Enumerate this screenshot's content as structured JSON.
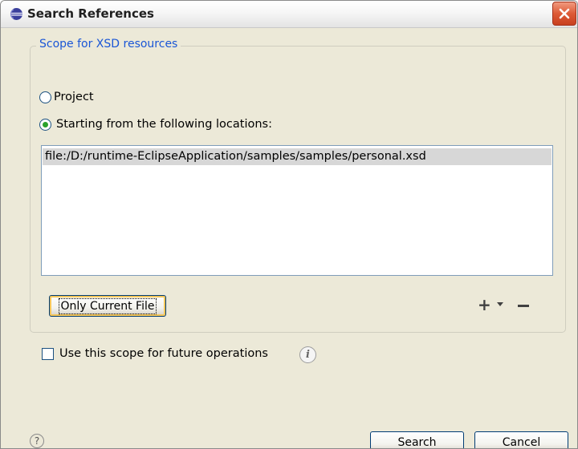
{
  "window": {
    "title": "Search References",
    "title_icon": "eclipse-icon",
    "close_icon": "close-icon"
  },
  "scope_group": {
    "legend": "Scope for XSD resources",
    "radio_project_label": "Project",
    "radio_locations_label": "Starting from the following locations:",
    "selected_option": "locations",
    "locations": [
      "file:/D:/runtime-EclipseApplication/samples/samples/personal.xsd"
    ],
    "only_current_file_label": "Only Current File",
    "add_icon": "plus-icon",
    "dropdown_icon": "triangle-down-icon",
    "remove_icon": "minus-icon"
  },
  "options": {
    "use_scope_label": "Use this scope for future operations",
    "use_scope_checked": false,
    "info_icon": "info-icon"
  },
  "footer": {
    "help_icon": "help-icon",
    "search_label": "Search",
    "cancel_label": "Cancel"
  },
  "colors": {
    "dialog_bg": "#ece9d8",
    "legend_text": "#1a56d6",
    "selection_bg": "#d7d7d7",
    "close_button": "#dd5a36"
  }
}
